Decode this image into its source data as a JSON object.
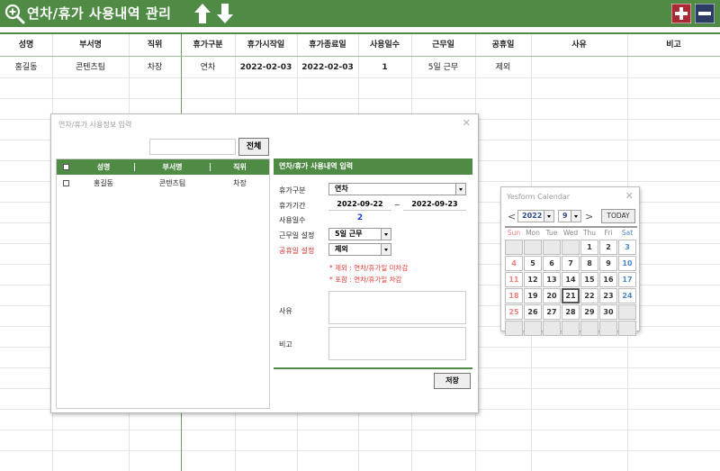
{
  "app": {
    "title": "연차/휴가 사용내역 관리"
  },
  "icons": {
    "search": "zoom-in-icon",
    "up": "arrow-up-icon",
    "down": "arrow-down-icon",
    "add": "plus-icon",
    "remove": "minus-icon"
  },
  "colors": {
    "accent": "#4f8b45",
    "red_button": "#a82a35",
    "blue_button": "#2b3d62",
    "note_red": "#e53935",
    "days_blue": "#1c3cd6"
  },
  "grid": {
    "columns": [
      "성명",
      "부서명",
      "직위",
      "휴가구분",
      "휴가시작일",
      "휴가종료일",
      "사용일수",
      "근무일",
      "공휴일",
      "사유",
      "비고"
    ],
    "rows": [
      [
        "홍길동",
        "콘텐츠팀",
        "차장",
        "연차",
        "2022-02-03",
        "2022-02-03",
        "1",
        "5일 근무",
        "제외",
        "",
        ""
      ]
    ]
  },
  "dialog": {
    "title": "연차/휴가 사용정보 입력",
    "search_value": "",
    "all_button": "전체",
    "list": {
      "headers": [
        "성명",
        "부서명",
        "직위"
      ],
      "rows": [
        [
          "홍길동",
          "콘텐츠팀",
          "차장"
        ]
      ]
    },
    "form": {
      "header": "연차/휴가 사용내역 입력",
      "labels": {
        "type": "휴가구분",
        "period": "휴가기간",
        "days": "사용일수",
        "workday": "근무일 설정",
        "holiday": "공휴일 설정",
        "reason": "사유",
        "remark": "비고"
      },
      "type_value": "연차",
      "start_date": "2022-09-22",
      "tilde": "~",
      "end_date": "2022-09-23",
      "days_value": "2",
      "workday_value": "5일 근무",
      "holiday_value": "제외",
      "note1": "* 제외 : 연차/휴가일 미차감",
      "note2": "* 포함 : 연차/휴가일 차감",
      "save_button": "저장"
    }
  },
  "calendar": {
    "title": "Yesform Calendar",
    "prev": "<",
    "next": ">",
    "year": "2022",
    "month": "9",
    "today_button": "TODAY",
    "weekdays": [
      "Sun",
      "Mon",
      "Tue",
      "Wed",
      "Thu",
      "Fri",
      "Sat"
    ],
    "weeks": [
      [
        "",
        "",
        "",
        "",
        "1",
        "2",
        "3"
      ],
      [
        "4",
        "5",
        "6",
        "7",
        "8",
        "9",
        "10"
      ],
      [
        "11",
        "12",
        "13",
        "14",
        "15",
        "16",
        "17"
      ],
      [
        "18",
        "19",
        "20",
        "21",
        "22",
        "23",
        "24"
      ],
      [
        "25",
        "26",
        "27",
        "28",
        "29",
        "30",
        ""
      ],
      [
        "",
        "",
        "",
        "",
        "",
        "",
        ""
      ]
    ],
    "selected_day": "21"
  }
}
